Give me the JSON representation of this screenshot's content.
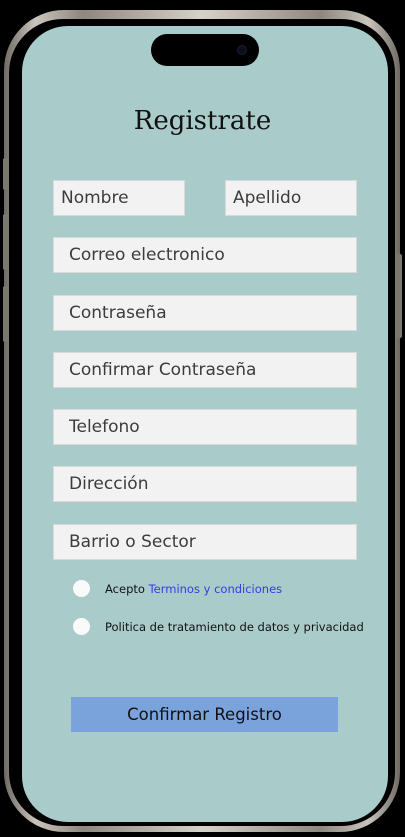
{
  "form": {
    "title": "Registrate",
    "fields": {
      "nombre": "Nombre",
      "apellido": "Apellido",
      "correo": "Correo electronico",
      "contrasena": "Contraseña",
      "confirmar": "Confirmar Contraseña",
      "telefono": "Telefono",
      "direccion": "Dirección",
      "barrio": "Barrio o Sector"
    },
    "consent": {
      "terms_prefix": "Acepto ",
      "terms_link": "Terminos y condiciones",
      "privacy": "Politica de tratamiento de datos y privacidad"
    },
    "submit_label": "Confirmar Registro"
  },
  "colors": {
    "screen_bg": "#a9cbc9",
    "field_bg": "#f2f2f2",
    "button_bg": "#7aa3dc",
    "link": "#3a3ae0"
  }
}
